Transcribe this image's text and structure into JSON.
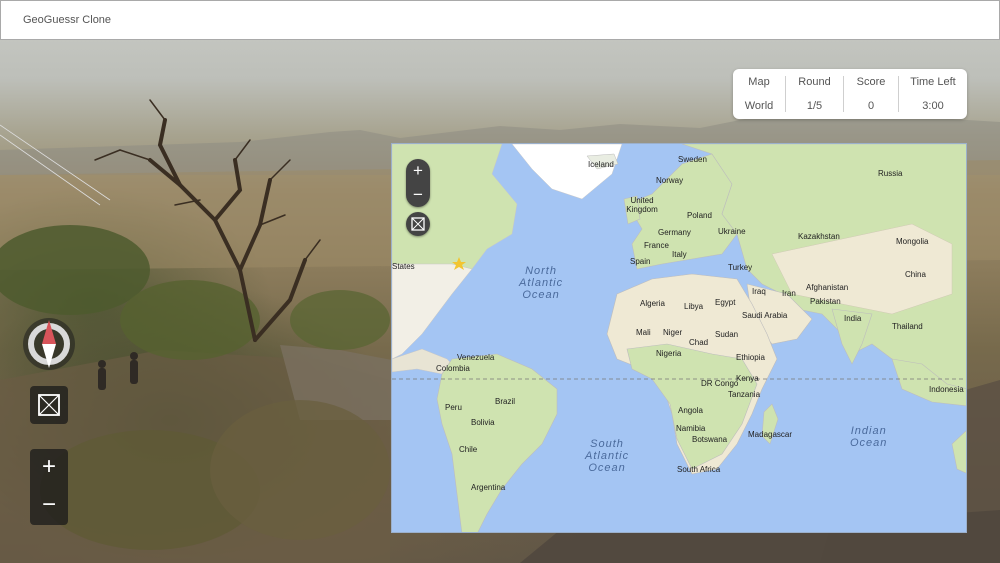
{
  "app": {
    "title": "GeoGuessr Clone"
  },
  "status": {
    "map": {
      "label": "Map",
      "value": "World"
    },
    "round": {
      "label": "Round",
      "value": "1/5"
    },
    "score": {
      "label": "Score",
      "value": "0"
    },
    "time": {
      "label": "Time Left",
      "value": "3:00"
    }
  },
  "street_view": {
    "compass_icon": "compass-icon",
    "reset_icon": "reset-view-icon",
    "zoom_in": "+",
    "zoom_out": "−"
  },
  "guess_map": {
    "zoom_in": "+",
    "zoom_out": "−",
    "reset_icon": "reset-view-icon",
    "marker_icon": "star-marker-icon",
    "oceans": [
      {
        "name": "North Atlantic Ocean",
        "lines": [
          "North",
          "Atlantic",
          "Ocean"
        ]
      },
      {
        "name": "South Atlantic Ocean",
        "lines": [
          "South",
          "Atlantic",
          "Ocean"
        ]
      },
      {
        "name": "Indian Ocean",
        "lines": [
          "Indian",
          "Ocean"
        ]
      }
    ],
    "countries": [
      "Iceland",
      "Sweden",
      "Norway",
      "Russia",
      "United Kingdom",
      "Poland",
      "Germany",
      "Ukraine",
      "France",
      "Kazakhstan",
      "Mongolia",
      "Italy",
      "Spain",
      "Turkey",
      "China",
      "Algeria",
      "Libya",
      "Egypt",
      "Iraq",
      "Iran",
      "Afghanistan",
      "Pakistan",
      "Saudi Arabia",
      "India",
      "Thailand",
      "Mali",
      "Niger",
      "Sudan",
      "Chad",
      "Ethiopia",
      "Nigeria",
      "Venezuela",
      "Colombia",
      "DR Congo",
      "Kenya",
      "Indonesia",
      "Peru",
      "Brazil",
      "Angola",
      "Tanzania",
      "Bolivia",
      "Namibia",
      "Botswana",
      "Madagascar",
      "Chile",
      "South Africa",
      "Argentina",
      "States"
    ]
  },
  "colors": {
    "land": "#f2efe6",
    "green": "#cfe3b0",
    "water": "#a4c5f3",
    "desert": "#efe9d4"
  }
}
